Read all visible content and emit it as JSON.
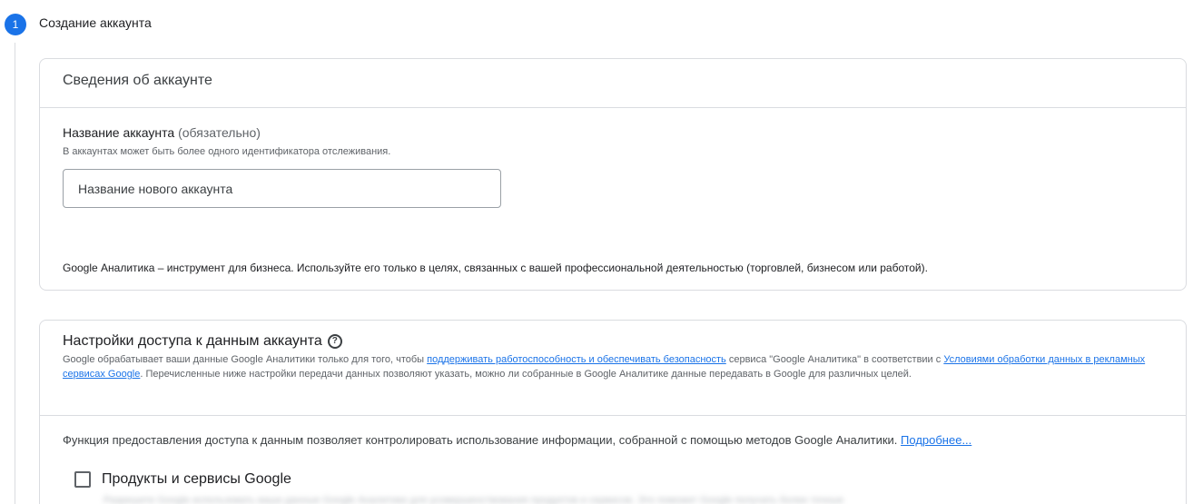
{
  "step": {
    "number": "1",
    "title": "Создание аккаунта"
  },
  "account_card": {
    "header": "Сведения об аккаунте",
    "field_label": "Название аккаунта",
    "field_label_optional": "(обязательно)",
    "field_hint": "В аккаунтах может быть более одного идентификатора отслеживания.",
    "input_placeholder": "Название нового аккаунта",
    "input_value": "",
    "footnote": "Google Аналитика – инструмент для бизнеса. Используйте его только в целях, связанных с вашей профессиональной деятельностью (торговлей, бизнесом или работой)."
  },
  "data_sharing_card": {
    "title": "Настройки доступа к данным аккаунта",
    "help_icon": "help-circle-icon",
    "desc_part1": "Google обрабатывает ваши данные Google Аналитики только для того, чтобы ",
    "desc_link1": "поддерживать работоспособность и обеспечивать безопасность",
    "desc_part2": " сервиса \"Google Аналитика\" в соответствии с ",
    "desc_link2": "Условиями обработки данных в рекламных сервисах Google",
    "desc_part3": ". Перечисленные ниже настройки передачи данных позволяют указать, можно ли собранные в Google Аналитике данные передавать в Google для различных целей.",
    "intro_text": "Функция предоставления доступа к данным позволяет контролировать использование информации, собранной с помощью методов Google Аналитики. ",
    "intro_link": "Подробнее...",
    "options": [
      {
        "label": "Продукты и сервисы Google",
        "checked": false,
        "description": "Разрешите Google использовать ваши данные Google Аналитики для усовершенствования продуктов и сервисов. Это поможет Google получать более точные"
      }
    ]
  },
  "colors": {
    "accent": "#1a73e8",
    "border": "#dadce0",
    "text": "#202124",
    "muted": "#5f6368"
  }
}
